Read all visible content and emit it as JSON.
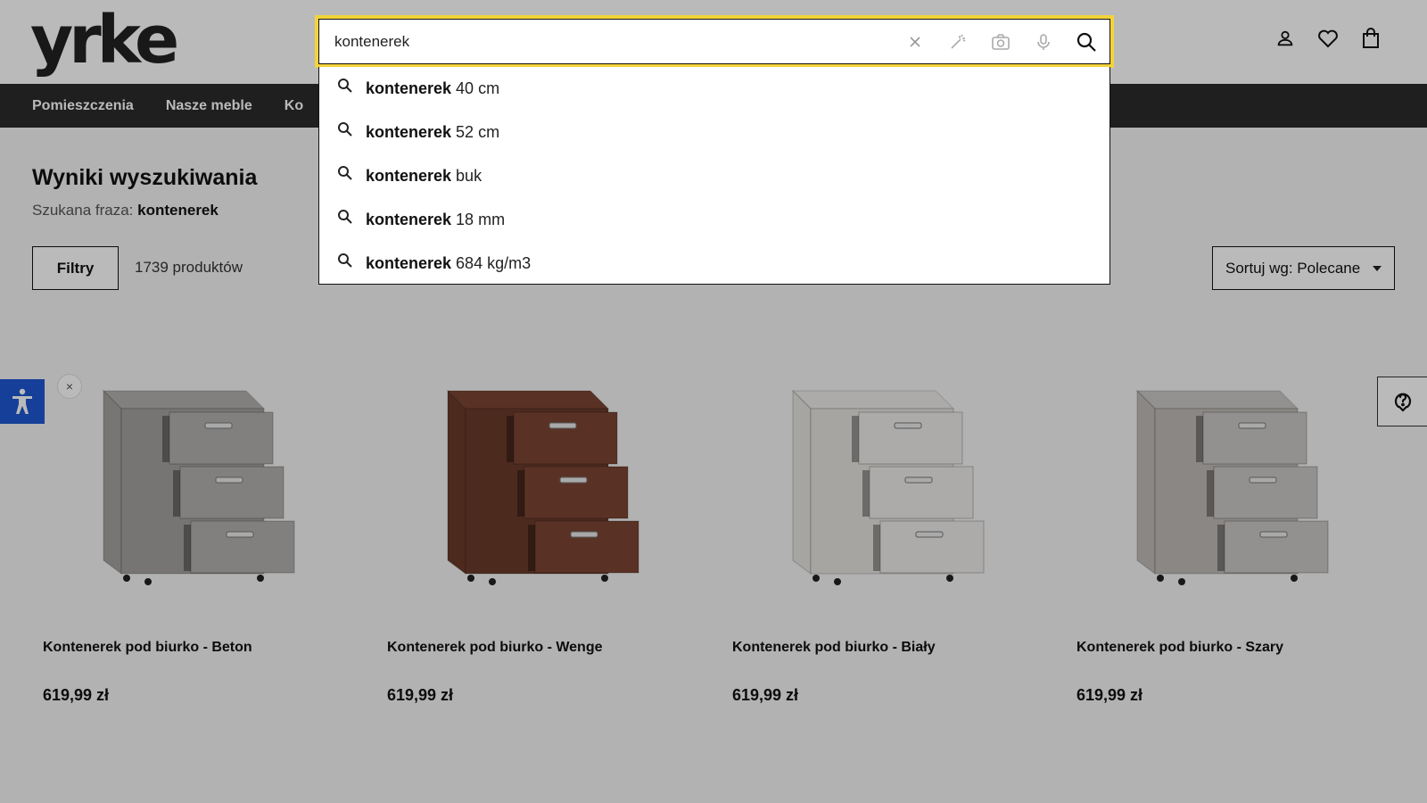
{
  "brand": {
    "logo_text": "yrke"
  },
  "header": {
    "icons": [
      "user-icon",
      "heart-icon",
      "shopping-bag-icon"
    ]
  },
  "nav": {
    "items": [
      {
        "label": "Pomieszczenia"
      },
      {
        "label": "Nasze meble"
      },
      {
        "label": "Ko"
      }
    ]
  },
  "search": {
    "value": "kontenerek",
    "tools": [
      "clear-icon",
      "magic-wand-icon",
      "camera-icon",
      "microphone-icon",
      "search-icon"
    ],
    "suggestions": [
      {
        "bold": "kontenerek",
        "rest": " 40 cm"
      },
      {
        "bold": "kontenerek",
        "rest": " 52 cm"
      },
      {
        "bold": "kontenerek",
        "rest": " buk"
      },
      {
        "bold": "kontenerek",
        "rest": " 18 mm"
      },
      {
        "bold": "kontenerek",
        "rest": " 684 kg/m3"
      }
    ]
  },
  "results": {
    "title": "Wyniki wyszukiwania",
    "query_label": "Szukana fraza:",
    "query_value": "kontenerek",
    "filters_label": "Filtry",
    "count_label": "1739 produktów",
    "sort_label": "Sortuj wg: Polecane"
  },
  "products": [
    {
      "name": "Kontenerek pod biurko - Beton",
      "price": "619,99 zł",
      "color": "#a3a19e",
      "drawer": "#b3b0ad"
    },
    {
      "name": "Kontenerek pod biurko - Wenge",
      "price": "619,99 zł",
      "color": "#6a3a2a",
      "drawer": "#7b4533"
    },
    {
      "name": "Kontenerek pod biurko - Biały",
      "price": "619,99 zł",
      "color": "#e4e2df",
      "drawer": "#ecebea"
    },
    {
      "name": "Kontenerek pod biurko - Szary",
      "price": "619,99 zł",
      "color": "#bdbab6",
      "drawer": "#c9c7c4"
    }
  ],
  "widgets": {
    "accessibility_close": "×"
  }
}
